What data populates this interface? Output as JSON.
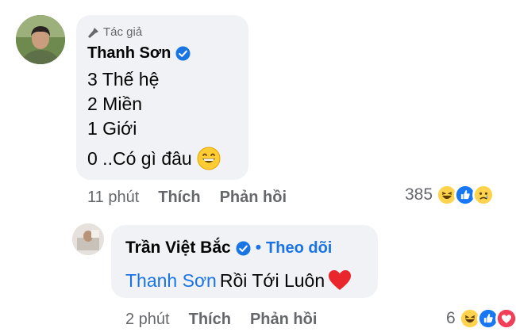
{
  "comment": {
    "author_badge": "Tác giả",
    "author_name": "Thanh Sơn",
    "lines": [
      "3 Thế hệ",
      "2 Miền",
      "1 Giới",
      "0 ..Có gì đâu"
    ],
    "time": "11 phút",
    "like_label": "Thích",
    "reply_label": "Phản hồi",
    "reaction_count": "385",
    "reaction_icons": [
      "haha-icon",
      "like-icon",
      "sad-icon"
    ]
  },
  "reply": {
    "author_name": "Trần Việt Bắc",
    "separator": "•",
    "follow_label": "Theo dõi",
    "mention": "Thanh Sơn",
    "text": "Rồi Tới Luôn",
    "time": "2 phút",
    "like_label": "Thích",
    "reply_label": "Phản hồi",
    "reaction_count": "6",
    "reaction_icons": [
      "haha-icon",
      "like-icon",
      "love-icon"
    ]
  },
  "colors": {
    "accent": "#1b74e4",
    "bubble": "#f0f2f5",
    "muted": "#65676b"
  }
}
